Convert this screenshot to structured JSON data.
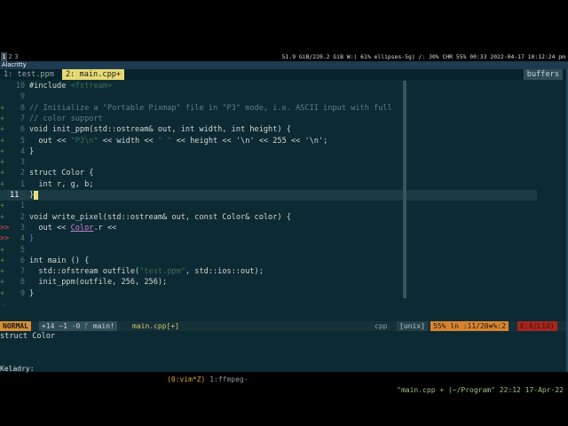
{
  "wm": {
    "workspaces": [
      "1",
      "2",
      "3"
    ],
    "status": "51.9 GiB/220.2 GiB W:( 61% ellipses-5g) /: 30% CHR 55% 00:33 2022-04-17 10:12:24 pm"
  },
  "window_title": "Alacritty",
  "tabs": {
    "tab1": "1: test.ppm",
    "tab2": "2: main.cpp+",
    "buffers": "buffers"
  },
  "editor": {
    "lines": [
      {
        "sign": "",
        "num": "10",
        "code": "#include <fstream>"
      },
      {
        "sign": "",
        "num": "9",
        "code": ""
      },
      {
        "sign": "+",
        "num": "8",
        "code": "// Initialize a \"Portable Pixmap\" file in \"P3\" mode, i.e. ASCII input with full"
      },
      {
        "sign": "+",
        "num": "7",
        "code": "// color support"
      },
      {
        "sign": "+",
        "num": "6",
        "code": "void init_ppm(std::ostream& out, int width, int height) {"
      },
      {
        "sign": "+",
        "num": "5",
        "code": "  out << \"P3\\n\" << width << \" \" << height << '\\n' << 255 << '\\n';"
      },
      {
        "sign": "+",
        "num": "4",
        "code": "}"
      },
      {
        "sign": "+",
        "num": "3",
        "code": ""
      },
      {
        "sign": "+",
        "num": "2",
        "code": "struct Color {"
      },
      {
        "sign": "+",
        "num": "1",
        "code": "  int r, g, b;"
      },
      {
        "sign": "",
        "num": "11",
        "code": "};"
      },
      {
        "sign": "+",
        "num": "1",
        "code": ""
      },
      {
        "sign": "+",
        "num": "2",
        "code": "void write_pixel(std::ostream& out, const Color& color) {"
      },
      {
        "sign": ">>",
        "num": "3",
        "code": "  out << Color.r <<"
      },
      {
        "sign": ">>",
        "num": "4",
        "code": "}"
      },
      {
        "sign": "+",
        "num": "5",
        "code": ""
      },
      {
        "sign": "+",
        "num": "6",
        "code": "int main () {"
      },
      {
        "sign": "+",
        "num": "7",
        "code": "  std::ofstream outfile(\"test.ppm\", std::ios::out);"
      },
      {
        "sign": "+",
        "num": "8",
        "code": "  init_ppm(outfile, 256, 256);"
      },
      {
        "sign": "+",
        "num": "9",
        "code": "}"
      }
    ],
    "tilde": "~"
  },
  "statusline": {
    "mode": "NORMAL",
    "git": "+14 ~1 -0 ᚴ main!",
    "filename": "main.cpp[+]",
    "filetype": "cpp",
    "format": "[unix]",
    "position": "55% ln :11/20≡%:2",
    "errors": "E:4(L14)"
  },
  "cmdline": "struct Color",
  "tmux": {
    "session": "Keladry:",
    "window1": "(0:vim*Z)",
    "window2": "1:ffmpeg-",
    "right": "\"main.cpp + (~/Program\" 22:12 17-Apr-22"
  }
}
